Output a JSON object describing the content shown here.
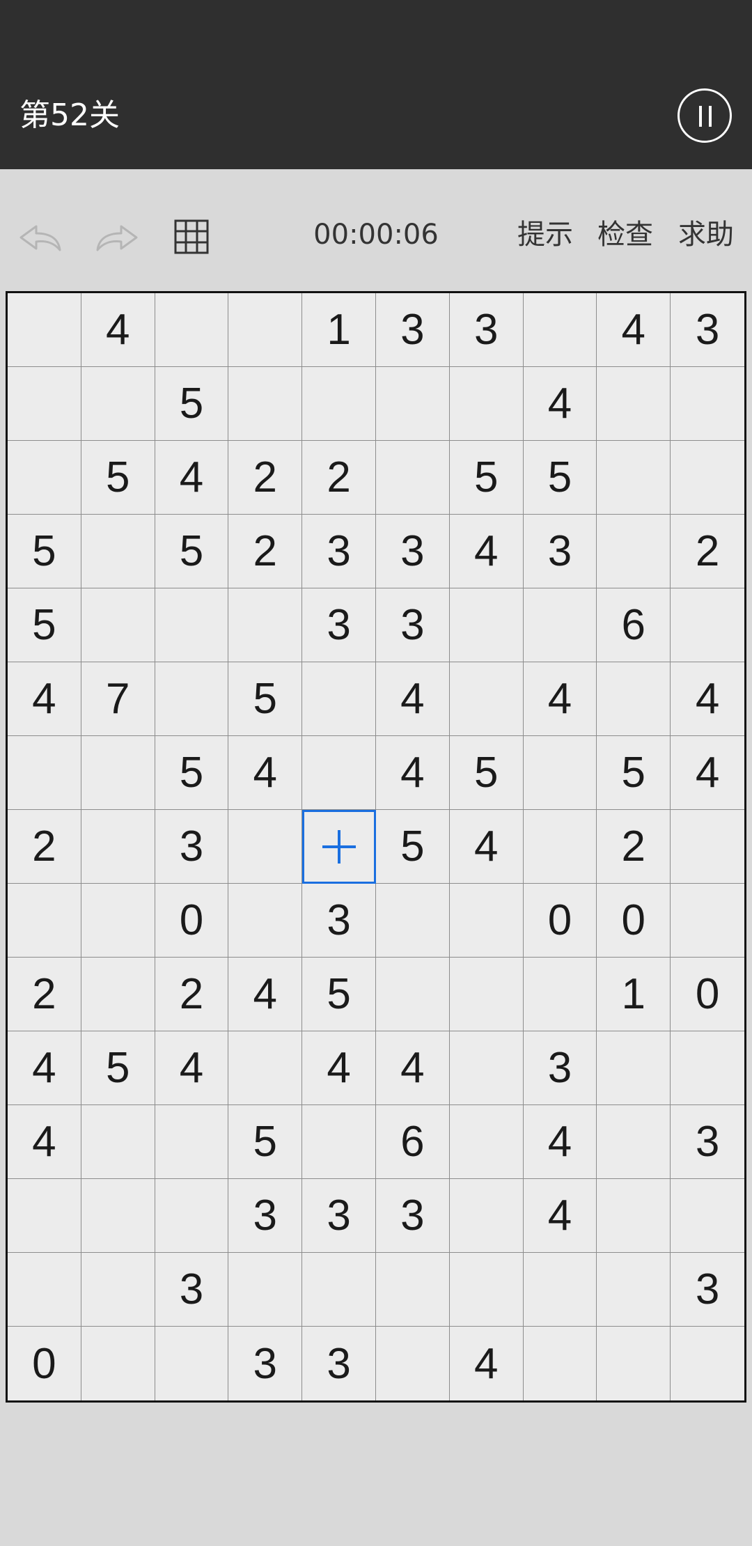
{
  "header": {
    "level_title": "第52关",
    "pause_icon": "pause-icon"
  },
  "toolbar": {
    "undo_icon": "undo-icon",
    "redo_icon": "redo-icon",
    "grid_icon": "grid-icon",
    "timer": "00:00:06",
    "hint_label": "提示",
    "check_label": "检查",
    "help_label": "求助"
  },
  "board": {
    "rows": 15,
    "cols": 10,
    "selected": {
      "row": 7,
      "col": 4,
      "icon": "plus-icon"
    },
    "accent_color": "#1a6fe0",
    "cells": [
      [
        "",
        "4",
        "",
        "",
        "1",
        "3",
        "3",
        "",
        "4",
        "3"
      ],
      [
        "",
        "",
        "5",
        "",
        "",
        "",
        "",
        "4",
        "",
        ""
      ],
      [
        "",
        "5",
        "4",
        "2",
        "2",
        "",
        "5",
        "5",
        "",
        ""
      ],
      [
        "5",
        "",
        "5",
        "2",
        "3",
        "3",
        "4",
        "3",
        "",
        "2"
      ],
      [
        "5",
        "",
        "",
        "",
        "3",
        "3",
        "",
        "",
        "6",
        ""
      ],
      [
        "4",
        "7",
        "",
        "5",
        "",
        "4",
        "",
        "4",
        "",
        "4"
      ],
      [
        "",
        "",
        "5",
        "4",
        "",
        "4",
        "5",
        "",
        "5",
        "4"
      ],
      [
        "2",
        "",
        "3",
        "",
        "",
        "5",
        "4",
        "",
        "2",
        ""
      ],
      [
        "",
        "",
        "0",
        "",
        "3",
        "",
        "",
        "0",
        "0",
        ""
      ],
      [
        "2",
        "",
        "2",
        "4",
        "5",
        "",
        "",
        "",
        "1",
        "0"
      ],
      [
        "4",
        "5",
        "4",
        "",
        "4",
        "4",
        "",
        "3",
        "",
        ""
      ],
      [
        "4",
        "",
        "",
        "5",
        "",
        "6",
        "",
        "4",
        "",
        "3"
      ],
      [
        "",
        "",
        "",
        "3",
        "3",
        "3",
        "",
        "4",
        "",
        ""
      ],
      [
        "",
        "",
        "3",
        "",
        "",
        "",
        "",
        "",
        "",
        "3"
      ],
      [
        "0",
        "",
        "",
        "3",
        "3",
        "",
        "4",
        "",
        "",
        ""
      ]
    ]
  }
}
